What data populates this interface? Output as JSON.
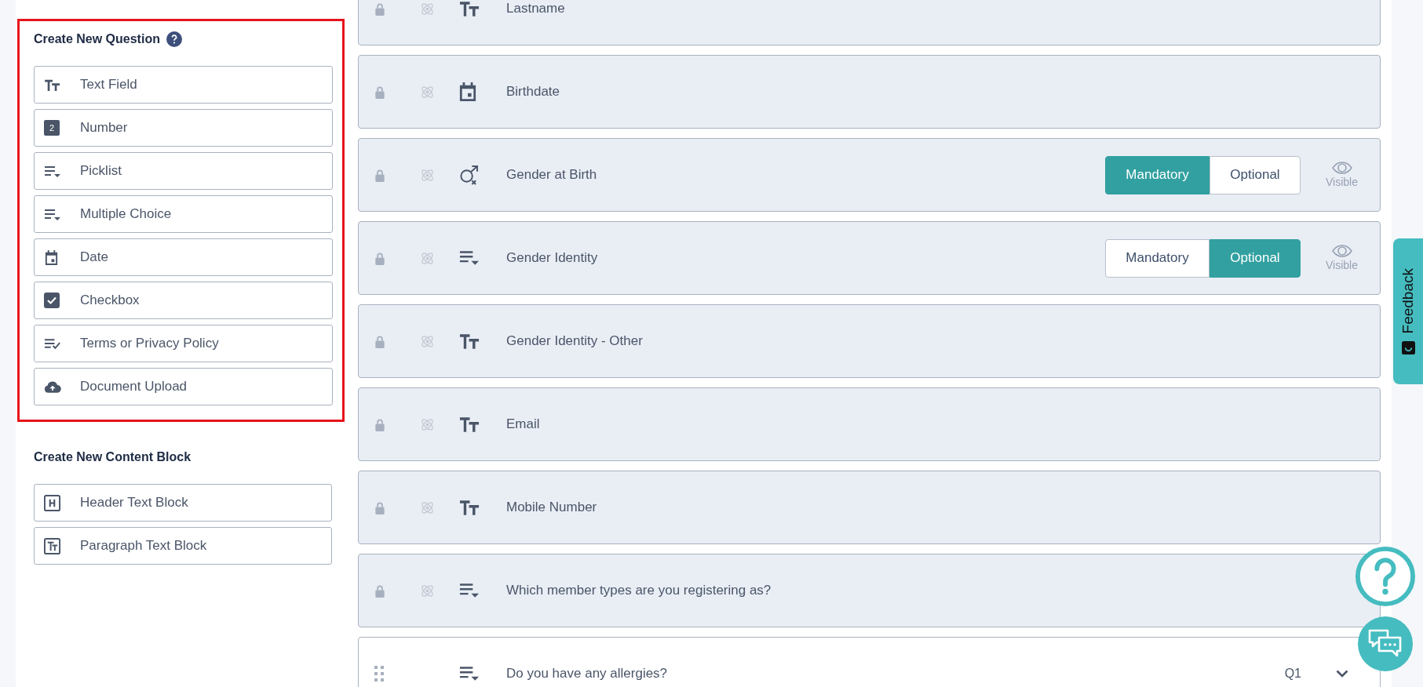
{
  "question_panel": {
    "title": "Create New Question",
    "highlighted": true,
    "types": [
      {
        "kind": "text",
        "label": "Text Field"
      },
      {
        "kind": "number",
        "label": "Number",
        "icon_text": "2"
      },
      {
        "kind": "list",
        "label": "Picklist"
      },
      {
        "kind": "list",
        "label": "Multiple Choice"
      },
      {
        "kind": "date",
        "label": "Date"
      },
      {
        "kind": "checkbox",
        "label": "Checkbox"
      },
      {
        "kind": "terms",
        "label": "Terms or Privacy Policy"
      },
      {
        "kind": "upload",
        "label": "Document Upload"
      }
    ]
  },
  "content_panel": {
    "title": "Create New Content Block",
    "types": [
      {
        "kind": "header",
        "label": "Header Text Block"
      },
      {
        "kind": "paragraph",
        "label": "Paragraph Text Block"
      }
    ]
  },
  "questions": [
    {
      "locked": true,
      "kind": "text",
      "label": "Lastname"
    },
    {
      "locked": true,
      "kind": "date",
      "label": "Birthdate"
    },
    {
      "locked": true,
      "kind": "gender",
      "label": "Gender at Birth",
      "requirement": [
        {
          "label": "Mandatory",
          "selected": true
        },
        {
          "label": "Optional",
          "selected": false
        }
      ],
      "visibility": "Visible"
    },
    {
      "locked": true,
      "kind": "list",
      "label": "Gender Identity",
      "requirement": [
        {
          "label": "Mandatory",
          "selected": false
        },
        {
          "label": "Optional",
          "selected": true
        }
      ],
      "visibility": "Visible"
    },
    {
      "locked": true,
      "kind": "text",
      "label": "Gender Identity - Other"
    },
    {
      "locked": true,
      "kind": "text",
      "label": "Email"
    },
    {
      "locked": true,
      "kind": "text",
      "label": "Mobile Number"
    },
    {
      "locked": true,
      "kind": "list",
      "label": "Which member types are you registering as?"
    },
    {
      "locked": false,
      "kind": "list",
      "label": "Do you have any allergies?",
      "number": "Q1"
    }
  ],
  "feedback_tab": "Feedback"
}
